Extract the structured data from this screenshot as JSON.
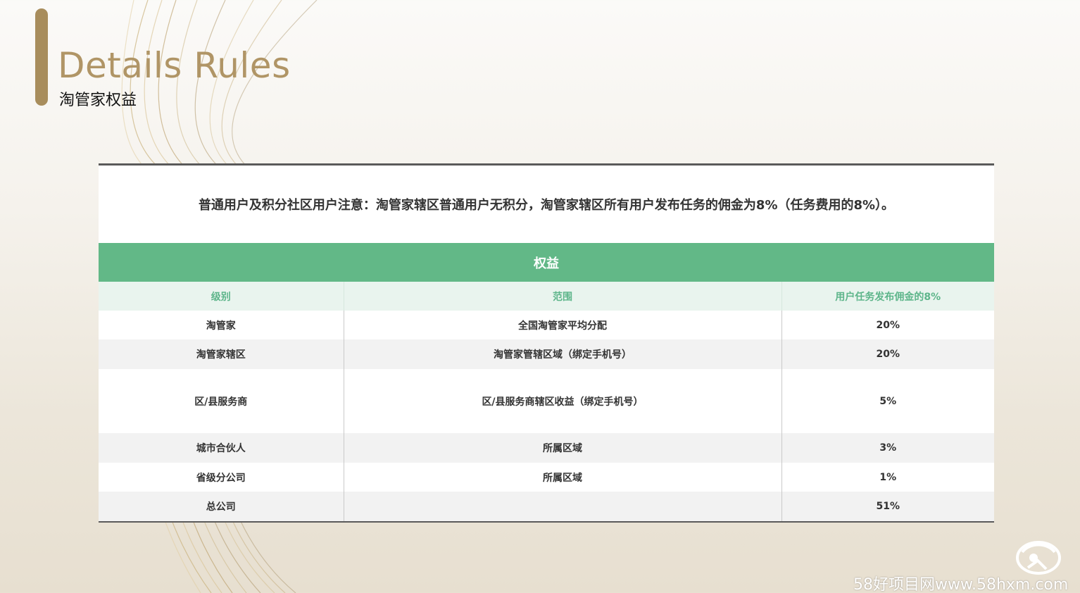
{
  "header": {
    "title_en": "Details Rules",
    "title_cn": "淘管家权益"
  },
  "notice": "普通用户及积分社区用户注意：淘管家辖区普通用户无积分，淘管家辖区所有用户发布任务的佣金为8%（任务费用的8%）。",
  "table": {
    "main_header": "权益",
    "columns": [
      "级别",
      "范围",
      "用户任务发布佣金的8%"
    ],
    "rows": [
      {
        "level": "淘管家",
        "scope": "全国淘管家平均分配",
        "rate": "20%"
      },
      {
        "level": "淘管家辖区",
        "scope": "淘管家管辖区域（绑定手机号）",
        "rate": "20%"
      },
      {
        "level": "区/县服务商",
        "scope": "区/县服务商辖区收益（绑定手机号）",
        "rate": "5%"
      },
      {
        "level": "城市合伙人",
        "scope": "所属区域",
        "rate": "3%"
      },
      {
        "level": "省级分公司",
        "scope": "所属区域",
        "rate": "1%"
      },
      {
        "level": "总公司",
        "scope": "",
        "rate": "51%"
      }
    ]
  },
  "watermark": "58好项目网www.58hxm.com",
  "colors": {
    "accent_gold": "#a88d5c",
    "table_header_green": "#62b887",
    "subheader_text_green": "#5db58a"
  }
}
